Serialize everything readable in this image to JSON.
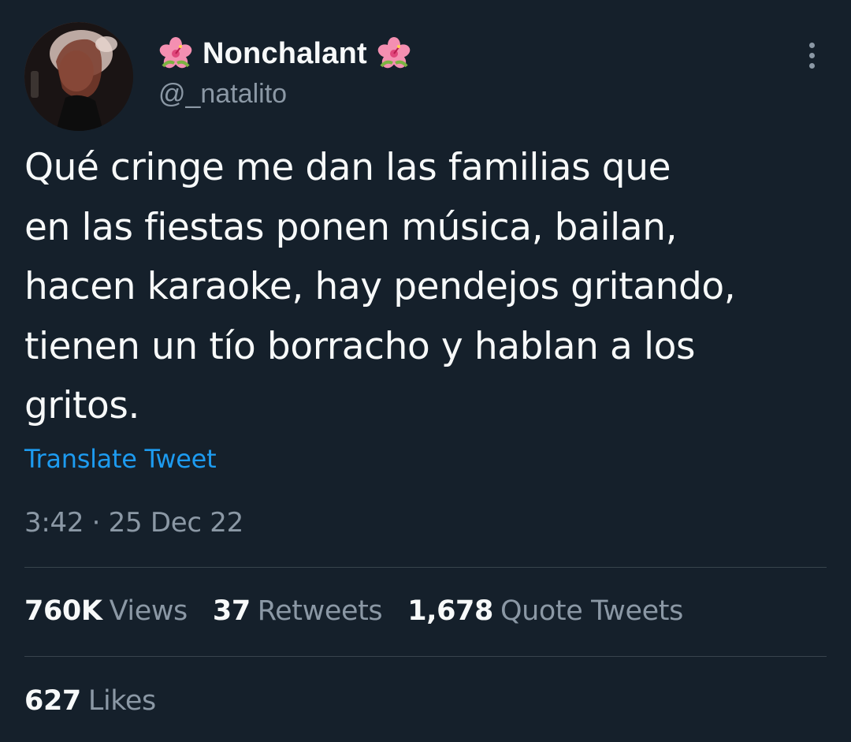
{
  "author": {
    "display_name": "Nonchalant",
    "handle": "@_natalito",
    "name_decoration_icon": "hibiscus-flower-icon"
  },
  "tweet": {
    "text_lines": [
      "Qué cringe me dan las familias que",
      "en las fiestas ponen música, bailan,",
      "hacen karaoke, hay pendejos gritando,",
      "tienen un tío borracho y hablan a los",
      "gritos."
    ],
    "translate_label": "Translate Tweet",
    "timestamp": "3:42 · 25 Dec 22"
  },
  "stats": {
    "views": {
      "count": "760K",
      "label": "Views"
    },
    "retweets": {
      "count": "37",
      "label": "Retweets"
    },
    "quote_tweets": {
      "count": "1,678",
      "label": "Quote Tweets"
    },
    "likes": {
      "count": "627",
      "label": "Likes"
    }
  },
  "colors": {
    "background": "#15202b",
    "primary_text": "#f7f9f9",
    "secondary_text": "#8b98a5",
    "link": "#1d9bf0",
    "divider": "#38444d"
  },
  "icons": {
    "more": "more-options-icon"
  }
}
